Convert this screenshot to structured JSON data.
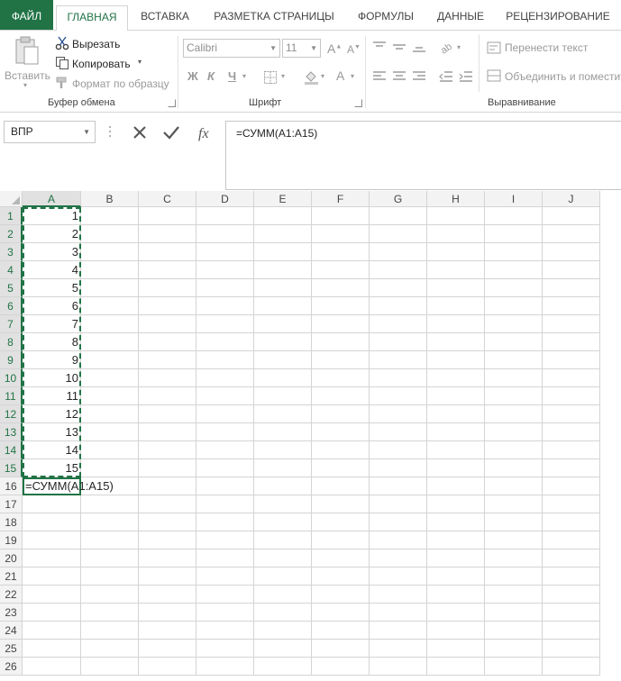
{
  "ribbon": {
    "tabs": [
      {
        "label": "ФАЙЛ"
      },
      {
        "label": "ГЛАВНАЯ"
      },
      {
        "label": "ВСТАВКА"
      },
      {
        "label": "РАЗМЕТКА СТРАНИЦЫ"
      },
      {
        "label": "ФОРМУЛЫ"
      },
      {
        "label": "ДАННЫЕ"
      },
      {
        "label": "РЕЦЕНЗИРОВАНИЕ"
      }
    ],
    "active_tab": "ГЛАВНАЯ",
    "clipboard": {
      "paste_label": "Вставить",
      "cut_label": "Вырезать",
      "copy_label": "Копировать",
      "format_painter_label": "Формат по образцу",
      "group_label": "Буфер обмена"
    },
    "font": {
      "font_name": "Calibri",
      "font_size": "11",
      "bold": "Ж",
      "italic": "К",
      "underline": "Ч",
      "group_label": "Шрифт"
    },
    "alignment": {
      "wrap_text_label": "Перенести текст",
      "merge_label": "Объединить и поместить в центре",
      "group_label": "Выравнивание"
    }
  },
  "formula_bar": {
    "name_box": "ВПР",
    "formula": "=СУММ(A1:A15)"
  },
  "grid": {
    "columns": [
      "A",
      "B",
      "C",
      "D",
      "E",
      "F",
      "G",
      "H",
      "I",
      "J"
    ],
    "rows": [
      "1",
      "2",
      "3",
      "4",
      "5",
      "6",
      "7",
      "8",
      "9",
      "10",
      "11",
      "12",
      "13",
      "14",
      "15",
      "16",
      "17",
      "18",
      "19",
      "20",
      "21",
      "22",
      "23",
      "24",
      "25",
      "26"
    ],
    "column_a_values": [
      "1",
      "2",
      "3",
      "4",
      "5",
      "6",
      "7",
      "8",
      "9",
      "10",
      "11",
      "12",
      "13",
      "14",
      "15"
    ],
    "editing_cell": {
      "ref": "A16",
      "content": "=СУММ(A1:A15)"
    },
    "marquee_range": "A1:A15"
  },
  "colors": {
    "accent": "#217346",
    "gridline": "#d4d4d4",
    "header_bg": "#f3f3f3",
    "header_selected_bg": "#e1e1e1"
  }
}
